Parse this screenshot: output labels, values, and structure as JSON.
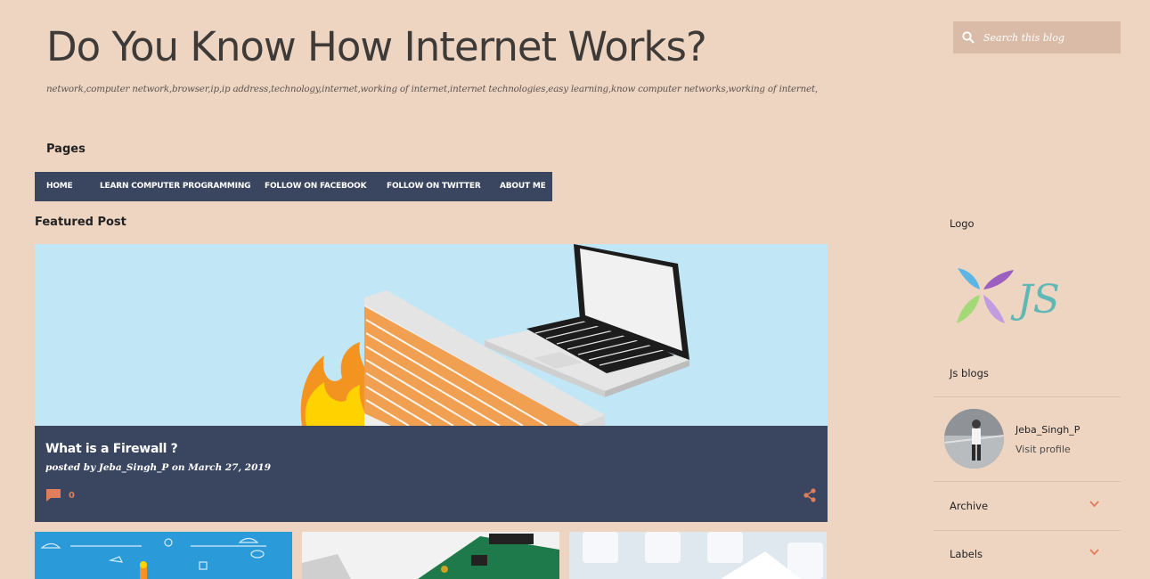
{
  "header": {
    "title": "Do You Know How Internet Works?",
    "description": "network,computer network,browser,ip,ip address,technology,internet,working of internet,internet technologies,easy learning,know computer networks,working of internet,"
  },
  "pages": {
    "heading": "Pages",
    "items": [
      {
        "label": "HOME"
      },
      {
        "label": "LEARN COMPUTER PROGRAMMING"
      },
      {
        "label": "FOLLOW ON FACEBOOK"
      },
      {
        "label": "FOLLOW ON TWITTER"
      },
      {
        "label": "ABOUT ME"
      }
    ]
  },
  "featured": {
    "heading": "Featured Post",
    "post_title": "What is a Firewall ?",
    "posted_by_prefix": "posted by",
    "author": "Jeba_Singh_P",
    "on_word": "on",
    "date": "March 27, 2019",
    "comment_count": "0"
  },
  "sidebar": {
    "search_placeholder": "Search this blog",
    "logo_heading": "Logo",
    "logo_text": "JS",
    "profile_heading": "Js blogs",
    "profile_name": "Jeba_Singh_P",
    "visit_profile": "Visit profile",
    "archive_label": "Archive",
    "labels_label": "Labels"
  },
  "icons": {
    "search": "search-icon",
    "comment": "comment-icon",
    "share": "share-icon",
    "chevron": "chevron-down-icon"
  },
  "colors": {
    "background": "#eed5c2",
    "nav": "#3a4560",
    "accent": "#e07d5a"
  }
}
